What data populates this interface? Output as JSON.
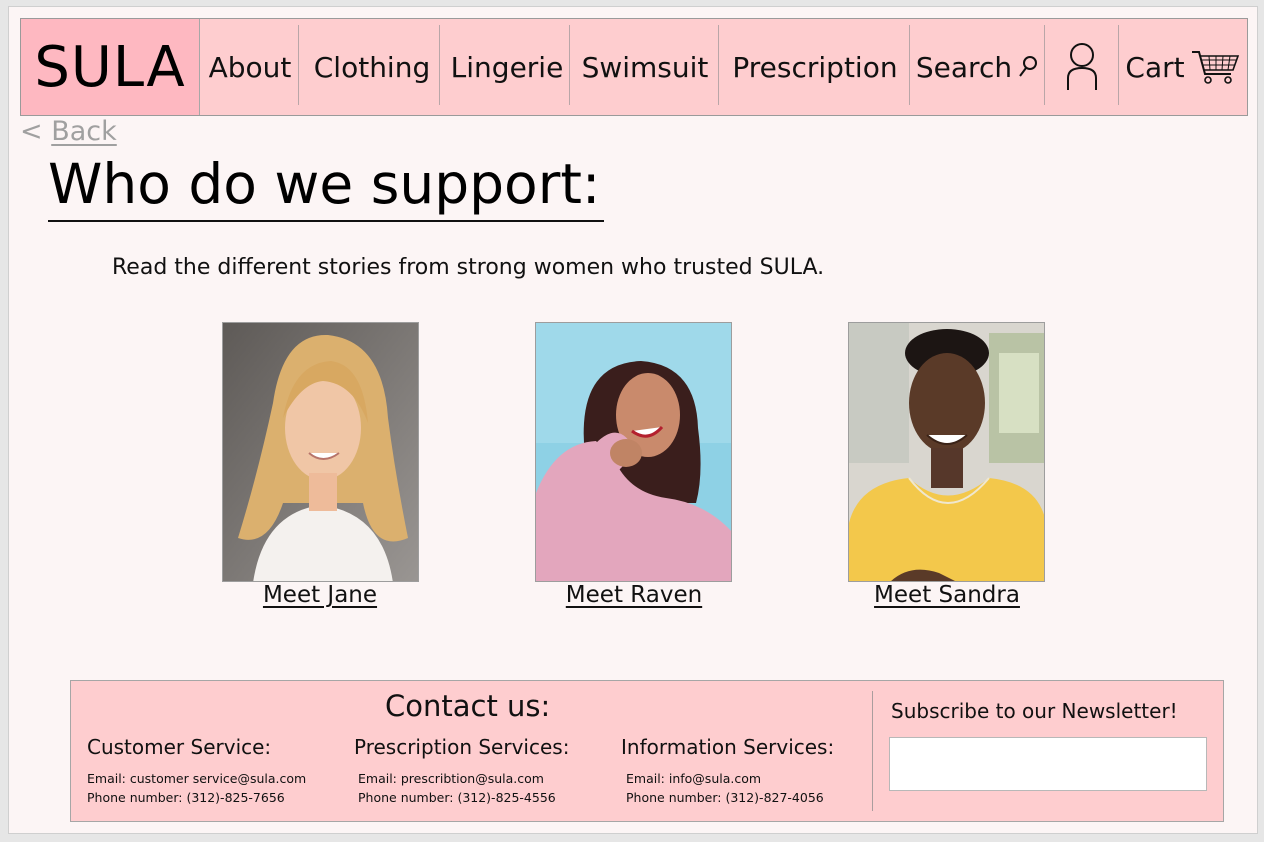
{
  "nav": {
    "logo": "SULA",
    "items": [
      "About",
      "Clothing",
      "Lingerie",
      "Swimsuit",
      "Prescription"
    ],
    "search_label": "Search",
    "cart_label": "Cart"
  },
  "back": {
    "arrow": "<",
    "label": "Back"
  },
  "page": {
    "heading": "Who do we support:",
    "intro": "Read the different stories from strong women who trusted SULA."
  },
  "cards": [
    {
      "link": "Meet Jane"
    },
    {
      "link": "Meet Raven"
    },
    {
      "link": "Meet Sandra"
    }
  ],
  "footer": {
    "contact_title": "Contact us:",
    "services": [
      {
        "title": "Customer Service:",
        "email": "Email: customer service@sula.com",
        "phone": "Phone number: (312)-825-7656"
      },
      {
        "title": "Prescription Services:",
        "email": "Email: prescribtion@sula.com",
        "phone": "Phone number: (312)-825-4556"
      },
      {
        "title": "Information Services:",
        "email": "Email: info@sula.com",
        "phone": "Phone number: (312)-827-4056"
      }
    ],
    "newsletter_title": "Subscribe to our Newsletter!",
    "newsletter_value": ""
  },
  "colors": {
    "nav_bg": "#fecdcf",
    "logo_bg": "#feb8c1",
    "page_bg": "#fcf5f5",
    "back_text": "#a0a0a0"
  }
}
